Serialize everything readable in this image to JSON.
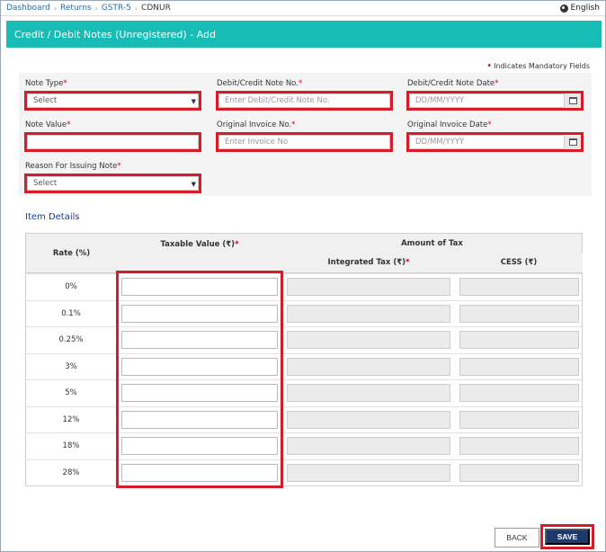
{
  "breadcrumb": {
    "items": [
      "Dashboard",
      "Returns",
      "GSTR-5"
    ],
    "current": "CDNUR"
  },
  "language": {
    "label": "English",
    "icon": "globe-icon"
  },
  "page_title": "Credit / Debit Notes (Unregistered) - Add",
  "mandatory_note": "Indicates Mandatory Fields",
  "form": {
    "note_type": {
      "label": "Note Type",
      "value": "Select"
    },
    "note_no": {
      "label": "Debit/Credit Note No.",
      "placeholder": "Enter Debit/Credit Note No."
    },
    "note_date": {
      "label": "Debit/Credit Note Date",
      "placeholder": "DD/MM/YYYY"
    },
    "note_value": {
      "label": "Note Value",
      "value": ""
    },
    "orig_invoice_no": {
      "label": "Original Invoice No.",
      "placeholder": "Enter Invoice No"
    },
    "orig_invoice_date": {
      "label": "Original Invoice Date",
      "placeholder": "DD/MM/YYYY"
    },
    "reason": {
      "label": "Reason For Issuing Note",
      "value": "Select"
    }
  },
  "item_details": {
    "title": "Item Details",
    "headers": {
      "rate": "Rate (%)",
      "taxable_value": "Taxable Value (₹)",
      "amount_of_tax": "Amount of Tax",
      "integrated_tax": "Integrated Tax (₹)",
      "cess": "CESS (₹)"
    },
    "rates": [
      "0%",
      "0.1%",
      "0.25%",
      "3%",
      "5%",
      "12%",
      "18%",
      "28%"
    ]
  },
  "buttons": {
    "back": "BACK",
    "save": "SAVE"
  },
  "colors": {
    "header_bg": "#17bdb4",
    "highlight": "#d31d2a",
    "save_bg": "#1e3a6d",
    "required": "#d0021b"
  }
}
